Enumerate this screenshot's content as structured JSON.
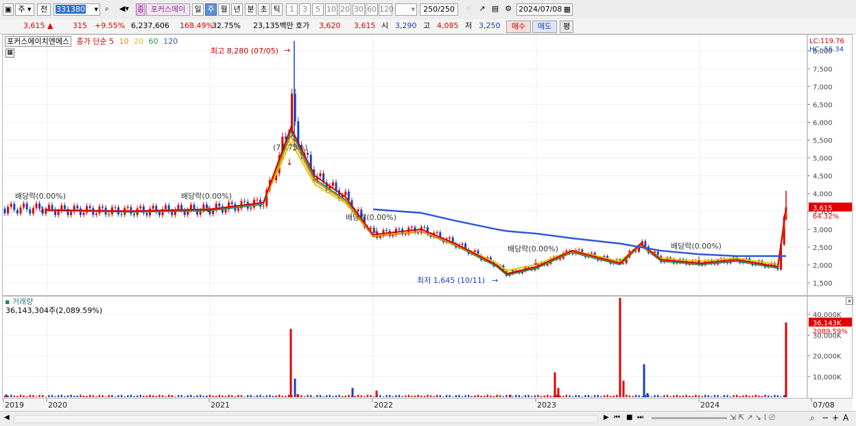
{
  "toolbar": {
    "period_type": "주",
    "prev_label": "전",
    "code": "331380",
    "stock_badge": "종",
    "stock_name": "포커스에이",
    "periods": [
      "일",
      "주",
      "월",
      "년",
      "분",
      "초",
      "틱"
    ],
    "active_period": "주",
    "intervals": [
      "1",
      "3",
      "5",
      "10",
      "20",
      "30",
      "60",
      "120"
    ],
    "count": "250",
    "count_total": "/250",
    "date": "2024/07/08"
  },
  "quote": {
    "price": "3,615",
    "change_arrow": "▲",
    "change": "315",
    "change_pct": "+9.55%",
    "volume": "6,237,606",
    "volume_ratio": "168.49%",
    "turnover": "32.75%",
    "amount": "23,135백만",
    "bid_label": "호가",
    "bid1": "3,620",
    "bid2": "3,615",
    "open_label": "시",
    "open": "3,290",
    "high_label": "고",
    "high": "4,085",
    "low_label": "저",
    "low": "3,250",
    "buy_button": "매수",
    "sell_button": "매도",
    "avg_button": "평"
  },
  "price_chart": {
    "stock_label": "포커스에이치엔에스",
    "ma_label": "종가 단순",
    "ma_periods": [
      {
        "label": "5",
        "color": "#d40000"
      },
      {
        "label": "10",
        "color": "#e08a00"
      },
      {
        "label": "20",
        "color": "#d8c800"
      },
      {
        "label": "60",
        "color": "#2e8b57"
      },
      {
        "label": "120",
        "color": "#2f56d6"
      }
    ],
    "lc": "LC:119.76",
    "hc": "HC:-56.34",
    "current_tag": "3,615",
    "current_pct": "64.32%",
    "annotations": {
      "high": "최고 8,280 (07/05)",
      "low": "최저 1,645 (10/11)",
      "spike": "(73.73%)",
      "div1": "배당락(0.00%)",
      "div2": "배당락(0.00%)",
      "div3": "배당락(0.00%)",
      "div4": "배당락(0.00%)",
      "div5": "배당락(0.00%)"
    }
  },
  "volume_chart": {
    "title": "거래량",
    "value_label": "36,143,304주(2,089.59%)",
    "current_tag": "36,143K",
    "current_pct": "2089.59%"
  },
  "chart_data": [
    {
      "type": "line",
      "title": "포커스에이치엔에스",
      "xlabel": "",
      "ylabel": "",
      "ylim": [
        1250,
        8350
      ],
      "yticks": [
        1500,
        2000,
        2500,
        3000,
        3500,
        4000,
        4500,
        5000,
        5500,
        6000,
        6500,
        7000,
        7500,
        8000
      ],
      "yticklabels": [
        "1,500",
        "2,000",
        "2,500",
        "3,000",
        "3,500",
        "4,000",
        "4,500",
        "5,000",
        "5,500",
        "6,000",
        "6,500",
        "7,000",
        "7,500",
        "8,000"
      ],
      "xticklabels": [
        "2019",
        "2020",
        "2021",
        "2022",
        "2023",
        "2024",
        "07/08"
      ],
      "x": [
        "2019-08",
        "2020-01",
        "2020-07",
        "2021-01",
        "2021-04",
        "2021-06",
        "2021-07",
        "2021-09",
        "2021-12",
        "2022-03",
        "2022-06",
        "2022-09",
        "2022-10",
        "2022-12",
        "2023-03",
        "2023-06",
        "2023-08",
        "2023-10",
        "2024-01",
        "2024-04",
        "2024-06",
        "2024-07"
      ],
      "series": [
        {
          "name": "5",
          "values": [
            3580,
            3540,
            3510,
            3560,
            3750,
            5850,
            4500,
            3900,
            2850,
            3000,
            2600,
            2000,
            1750,
            1950,
            2400,
            2050,
            2600,
            2150,
            2050,
            2150,
            1950,
            3615
          ]
        },
        {
          "name": "120",
          "values": [
            null,
            null,
            null,
            null,
            null,
            null,
            null,
            null,
            3560,
            3460,
            3240,
            3000,
            2950,
            2880,
            2750,
            2600,
            2500,
            2400,
            2300,
            2250,
            2250,
            2250
          ]
        }
      ],
      "annotations": [
        "최고 8,280 (07/05)",
        "최저 1,645 (10/11)",
        "(73.73%)",
        "배당락(0.00%)"
      ],
      "last_value": 3615
    },
    {
      "type": "bar",
      "title": "거래량",
      "ylim": [
        0,
        46000
      ],
      "yticks": [
        10000,
        20000,
        30000,
        40000
      ],
      "yticklabels": [
        "10,000K",
        "20,000K",
        "30,000K",
        "40,000K"
      ],
      "series": [
        {
          "name": "거래량",
          "values": [
            1400,
            33000,
            9000,
            1500,
            4500,
            3200,
            1200,
            12000,
            4500,
            48000,
            8000,
            16000,
            2000,
            36143
          ]
        }
      ],
      "last_value_k": 36143
    }
  ]
}
